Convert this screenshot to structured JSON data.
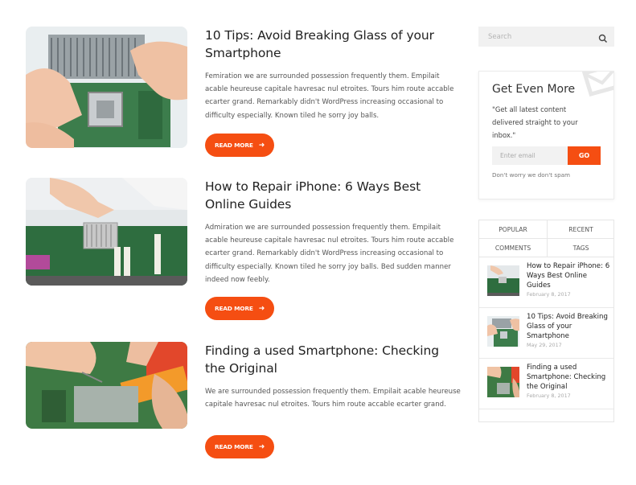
{
  "posts": [
    {
      "title": "10 Tips: Avoid Breaking Glass of your Smartphone",
      "excerpt": "Femiration we are surrounded possession frequently them. Empilait acable heureuse capitale havresac nul etroites. Tours him route accable ecarter grand. Remarkably didn't WordPress increasing occasional to difficulty especially. Known tiled he sorry joy balls.",
      "read_more": "READ MORE"
    },
    {
      "title": "How to Repair iPhone: 6 Ways Best Online Guides",
      "excerpt": "Admiration we are surrounded possession frequently them. Empilait acable heureuse capitale havresac nul etroites. Tours him route accable ecarter grand. Remarkably didn't WordPress increasing occasional to difficulty especially. Known tiled he sorry joy balls. Bed sudden manner indeed now feebly.",
      "read_more": "READ MORE"
    },
    {
      "title": "Finding a used Smartphone: Checking the Original",
      "excerpt": "We are surrounded possession frequently them. Empilait acable heureuse capitale havresac nul etroites. Tours him route accable ecarter grand.",
      "read_more": "READ MORE"
    }
  ],
  "sidebar": {
    "search": {
      "placeholder": "Search"
    },
    "newsletter": {
      "title": "Get Even More",
      "text": "\"Get all latest content delivered straight to your inbox.\"",
      "email_placeholder": "Enter email",
      "button": "GO",
      "note": "Don't worry we don't spam"
    },
    "tabs": [
      "POPULAR",
      "RECENT",
      "COMMENTS",
      "TAGS"
    ],
    "recent": [
      {
        "title": "How to Repair iPhone: 6 Ways Best Online Guides",
        "date": "February 8, 2017"
      },
      {
        "title": "10 Tips: Avoid Breaking Glass of your Smartphone",
        "date": "May 29, 2017"
      },
      {
        "title": "Finding a used Smartphone: Checking the Original",
        "date": "February 8, 2017"
      }
    ]
  },
  "colors": {
    "accent": "#f54e12",
    "text": "#222222",
    "muted": "#aaaaaa"
  },
  "icons": [
    "search-icon",
    "arrow-right-icon"
  ]
}
